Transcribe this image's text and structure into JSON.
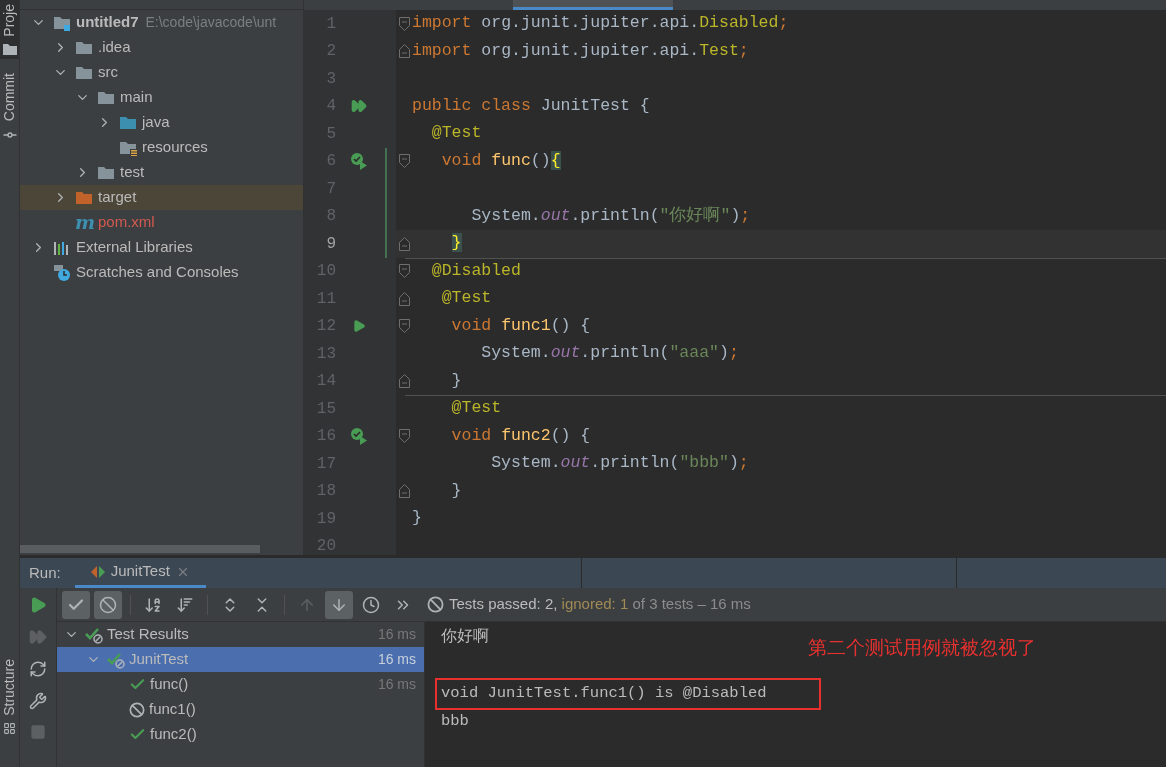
{
  "left_tabs_top": [
    {
      "label": "Proje",
      "selected": true,
      "kind": "project"
    },
    {
      "label": "Commit",
      "selected": false,
      "kind": "commit"
    }
  ],
  "left_tabs_bottom": [
    {
      "label": "Structure",
      "selected": false,
      "kind": "structure"
    }
  ],
  "project_tree": [
    {
      "label": "untitled7",
      "hint": "E:\\code\\javacode\\unt",
      "kind": "module",
      "expanded": true,
      "selected": false,
      "children": [
        {
          "label": ".idea",
          "kind": "folder",
          "expanded": false,
          "selected": false
        },
        {
          "label": "src",
          "kind": "folder",
          "expanded": true,
          "selected": false,
          "children": [
            {
              "label": "main",
              "kind": "folder",
              "expanded": true,
              "selected": false,
              "children": [
                {
                  "label": "java",
                  "kind": "source-folder",
                  "expanded": false,
                  "selected": false
                },
                {
                  "label": "resources",
                  "kind": "resources-folder",
                  "selected": false
                }
              ]
            },
            {
              "label": "test",
              "kind": "folder",
              "expanded": false,
              "selected": false
            }
          ]
        },
        {
          "label": "target",
          "kind": "excluded-folder",
          "expanded": false,
          "selected": true
        },
        {
          "label": "pom.xml",
          "kind": "maven",
          "glyph": "m",
          "color": "#d25a4e",
          "selected": false
        }
      ]
    },
    {
      "label": "External Libraries",
      "kind": "libraries",
      "expanded": false,
      "selected": false
    },
    {
      "label": "Scratches and Consoles",
      "kind": "scratches",
      "selected": false
    }
  ],
  "editor": {
    "lines": [
      {
        "number": "1",
        "fold": {
          "kind": "start"
        },
        "tokens": [
          {
            "kind": "keyword",
            "text": "import"
          },
          {
            "kind": "text",
            "text": " org.junit.jupiter.api."
          },
          {
            "kind": "annotation",
            "text": "Disabled"
          },
          {
            "kind": "keyword",
            "text": ";"
          }
        ]
      },
      {
        "number": "2",
        "fold": {
          "kind": "end"
        },
        "tokens": [
          {
            "kind": "keyword",
            "text": "import"
          },
          {
            "kind": "text",
            "text": " org.junit.jupiter.api."
          },
          {
            "kind": "annotation",
            "text": "Test"
          },
          {
            "kind": "keyword",
            "text": ";"
          }
        ]
      },
      {
        "number": "3"
      },
      {
        "number": "4",
        "gutter": {
          "kind": "run-all"
        },
        "tokens": [
          {
            "kind": "keyword",
            "text": "public class"
          },
          {
            "kind": "text",
            "text": " JunitTest {"
          }
        ]
      },
      {
        "number": "5",
        "tokens": [
          {
            "kind": "annotation",
            "text": "  @Test"
          }
        ]
      },
      {
        "number": "6",
        "gutter": {
          "kind": "rerun"
        },
        "fold": {
          "kind": "start"
        },
        "changed": true,
        "tokens": [
          {
            "kind": "keyword",
            "text": "   void"
          },
          {
            "kind": "method",
            "text": " func"
          },
          {
            "kind": "text",
            "text": "()"
          },
          {
            "kind": "brace",
            "text": "{",
            "matched": true
          }
        ]
      },
      {
        "number": "7",
        "changed": true
      },
      {
        "number": "8",
        "changed": true,
        "tokens": [
          {
            "kind": "text",
            "text": "      System."
          },
          {
            "kind": "field",
            "text": "out"
          },
          {
            "kind": "text",
            "text": ".println("
          },
          {
            "kind": "string",
            "text": "\"你好啊\""
          },
          {
            "kind": "text",
            "text": ")"
          },
          {
            "kind": "keyword",
            "text": ";"
          }
        ]
      },
      {
        "number": "9",
        "fold": {
          "kind": "end"
        },
        "changed": true,
        "current": true,
        "tokens": [
          {
            "kind": "brace",
            "text": "    }",
            "matched": true
          }
        ]
      },
      {
        "number": "10",
        "fold": {
          "kind": "start"
        },
        "separator_above": true,
        "tokens": [
          {
            "kind": "annotation",
            "text": "  @Disabled"
          }
        ]
      },
      {
        "number": "11",
        "fold": {
          "kind": "end"
        },
        "tokens": [
          {
            "kind": "annotation",
            "text": "   @Test"
          }
        ]
      },
      {
        "number": "12",
        "gutter": {
          "kind": "run"
        },
        "fold": {
          "kind": "start"
        },
        "tokens": [
          {
            "kind": "keyword",
            "text": "    void"
          },
          {
            "kind": "method",
            "text": " func1"
          },
          {
            "kind": "text",
            "text": "() {"
          }
        ]
      },
      {
        "number": "13",
        "tokens": [
          {
            "kind": "text",
            "text": "       System."
          },
          {
            "kind": "field",
            "text": "out"
          },
          {
            "kind": "text",
            "text": ".println("
          },
          {
            "kind": "string",
            "text": "\"aaa\""
          },
          {
            "kind": "text",
            "text": ")"
          },
          {
            "kind": "keyword",
            "text": ";"
          }
        ]
      },
      {
        "number": "14",
        "fold": {
          "kind": "end"
        },
        "tokens": [
          {
            "kind": "text",
            "text": "    }"
          }
        ]
      },
      {
        "number": "15",
        "separator_above": true,
        "tokens": [
          {
            "kind": "annotation",
            "text": "    @Test"
          }
        ]
      },
      {
        "number": "16",
        "gutter": {
          "kind": "rerun"
        },
        "fold": {
          "kind": "start"
        },
        "tokens": [
          {
            "kind": "keyword",
            "text": "    void"
          },
          {
            "kind": "method",
            "text": " func2"
          },
          {
            "kind": "text",
            "text": "() {"
          }
        ]
      },
      {
        "number": "17",
        "tokens": [
          {
            "kind": "text",
            "text": "        System."
          },
          {
            "kind": "field",
            "text": "out"
          },
          {
            "kind": "text",
            "text": ".println("
          },
          {
            "kind": "string",
            "text": "\"bbb\""
          },
          {
            "kind": "text",
            "text": ")"
          },
          {
            "kind": "keyword",
            "text": ";"
          }
        ]
      },
      {
        "number": "18",
        "fold": {
          "kind": "end"
        },
        "tokens": [
          {
            "kind": "text",
            "text": "    }"
          }
        ]
      },
      {
        "number": "19",
        "tokens": [
          {
            "kind": "text",
            "text": "}"
          }
        ]
      },
      {
        "number": "20"
      }
    ]
  },
  "run_window": {
    "label": "Run:",
    "tabs": [
      {
        "label": "JunitTest",
        "selected": true
      }
    ],
    "side_tools": [
      {
        "kind": "run",
        "disabled": false
      },
      {
        "kind": "rerun-failed",
        "disabled": true
      },
      {
        "kind": "auto-test",
        "disabled": false
      },
      {
        "kind": "settings",
        "disabled": false
      },
      {
        "kind": "stop",
        "disabled": true
      }
    ],
    "toolbar": [
      {
        "kind": "show-passed",
        "toggled": true,
        "disabled": false
      },
      {
        "kind": "show-ignored",
        "toggled": true,
        "disabled": false
      },
      {
        "kind": "sort-alpha",
        "toggled": false,
        "disabled": false
      },
      {
        "kind": "sort-duration",
        "toggled": false,
        "disabled": false
      },
      {
        "kind": "expand-all",
        "toggled": false,
        "disabled": false
      },
      {
        "kind": "collapse-all",
        "toggled": false,
        "disabled": false
      },
      {
        "kind": "previous",
        "toggled": false,
        "disabled": true
      },
      {
        "kind": "next",
        "toggled": true,
        "disabled": false
      },
      {
        "kind": "history",
        "toggled": false,
        "disabled": false
      },
      {
        "kind": "more",
        "toggled": false,
        "disabled": false
      }
    ],
    "status": [
      {
        "kind": "normal",
        "text": "Tests passed: 2, "
      },
      {
        "kind": "ignored",
        "text": "ignored: 1"
      },
      {
        "kind": "dim",
        "text": " of 3 tests – 16 ms"
      }
    ],
    "tests": [
      {
        "label": "Test Results",
        "kind": "mixed",
        "time": "16 ms",
        "expanded": true,
        "selected": false,
        "children": [
          {
            "label": "JunitTest",
            "kind": "mixed",
            "time": "16 ms",
            "expanded": true,
            "selected": true,
            "children": [
              {
                "label": "func()",
                "kind": "passed",
                "time": "16 ms",
                "selected": false
              },
              {
                "label": "func1()",
                "kind": "ignored",
                "selected": false
              },
              {
                "label": "func2()",
                "kind": "passed",
                "selected": false
              }
            ]
          }
        ]
      }
    ],
    "console": [
      {
        "text": "你好啊",
        "boxed": false
      },
      {
        "text": "void JunitTest.func1() is @Disabled",
        "boxed": true
      },
      {
        "text": "bbb",
        "boxed": false
      }
    ],
    "note": "第二个测试用例就被忽视了"
  }
}
